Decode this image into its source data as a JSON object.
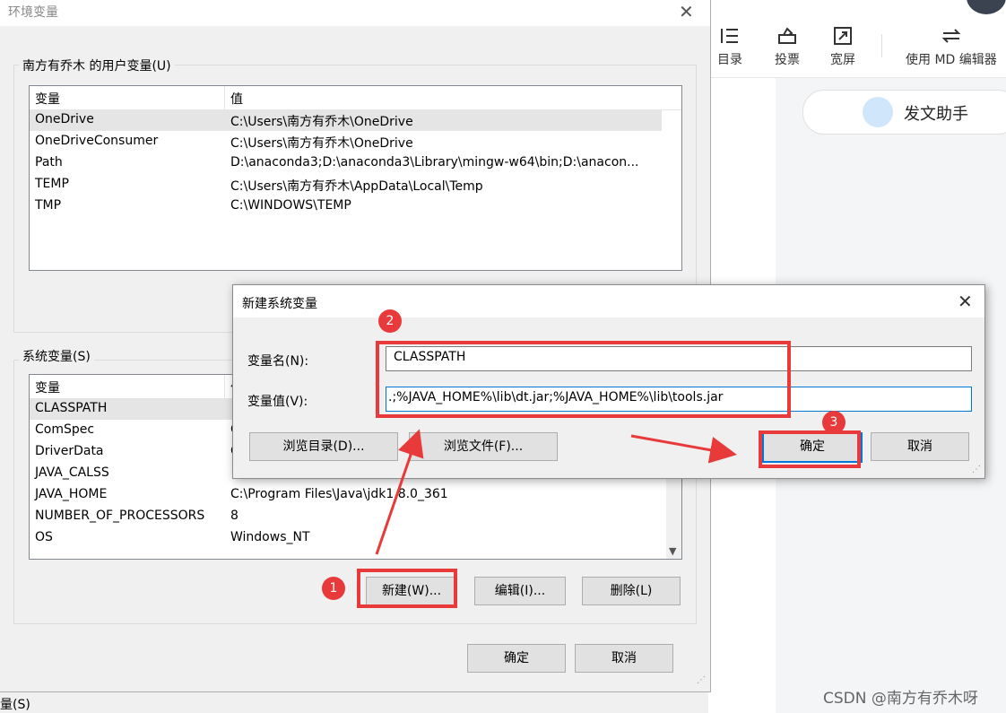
{
  "env_window": {
    "title": "环境变量",
    "user_group_label": "南方有乔木 的用户变量(U)",
    "col_var": "变量",
    "col_val": "值",
    "user_vars": [
      {
        "name": "OneDrive",
        "value": "C:\\Users\\南方有乔木\\OneDrive"
      },
      {
        "name": "OneDriveConsumer",
        "value": "C:\\Users\\南方有乔木\\OneDrive"
      },
      {
        "name": "Path",
        "value": "D:\\anaconda3;D:\\anaconda3\\Library\\mingw-w64\\bin;D:\\anacon..."
      },
      {
        "name": "TEMP",
        "value": "C:\\Users\\南方有乔木\\AppData\\Local\\Temp"
      },
      {
        "name": "TMP",
        "value": "C:\\WINDOWS\\TEMP"
      }
    ],
    "sys_group_label": "系统变量(S)",
    "sys_vars": [
      {
        "name": "CLASSPATH",
        "value": ""
      },
      {
        "name": "ComSpec",
        "value": "C"
      },
      {
        "name": "DriverData",
        "value": "C"
      },
      {
        "name": "JAVA_CALSS",
        "value": ""
      },
      {
        "name": "JAVA_HOME",
        "value": "C:\\Program Files\\Java\\jdk1.8.0_361"
      },
      {
        "name": "NUMBER_OF_PROCESSORS",
        "value": "8"
      },
      {
        "name": "OS",
        "value": "Windows_NT"
      }
    ],
    "btn_new": "新建(W)...",
    "btn_edit": "编辑(I)...",
    "btn_delete": "删除(L)",
    "btn_ok": "确定",
    "btn_cancel": "取消",
    "bottom_partial_label": "量(S)"
  },
  "new_dialog": {
    "title": "新建系统变量",
    "name_label": "变量名(N):",
    "value_label": "变量值(V):",
    "name_value": "CLASSPATH",
    "value_value": ".;%JAVA_HOME%\\lib\\dt.jar;%JAVA_HOME%\\lib\\tools.jar",
    "btn_browse_dir": "浏览目录(D)...",
    "btn_browse_file": "浏览文件(F)...",
    "btn_ok": "确定",
    "btn_cancel": "取消"
  },
  "annotations": {
    "badge1": "1",
    "badge2": "2",
    "badge3": "3",
    "color": "#e83a3a"
  },
  "right_page": {
    "toolbar": [
      {
        "label": "目录",
        "icon": "toc-icon"
      },
      {
        "label": "投票",
        "icon": "vote-icon"
      },
      {
        "label": "宽屏",
        "icon": "widescreen-icon"
      },
      {
        "label": "使用 MD 编辑器",
        "icon": "swap-icon"
      }
    ],
    "assistant_label": "发文助手"
  },
  "watermark": "CSDN @南方有乔木呀"
}
